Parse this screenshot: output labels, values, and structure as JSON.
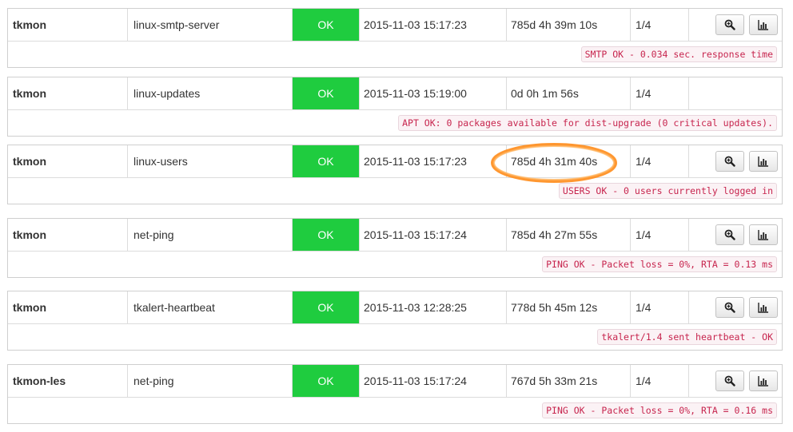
{
  "services": [
    {
      "host": "tkmon",
      "service": "linux-smtp-server",
      "state": "OK",
      "last_check": "2015-11-03 15:17:23",
      "duration": "785d 4h 39m 10s",
      "attempt": "1/4",
      "output": "SMTP OK - 0.034 sec. response time",
      "has_actions": true
    },
    {
      "host": "tkmon",
      "service": "linux-updates",
      "state": "OK",
      "last_check": "2015-11-03 15:19:00",
      "duration": "0d 0h 1m 56s",
      "attempt": "1/4",
      "output": "APT OK: 0 packages available for dist-upgrade (0 critical updates).",
      "has_actions": false
    },
    {
      "host": "tkmon",
      "service": "linux-users",
      "state": "OK",
      "last_check": "2015-11-03 15:17:23",
      "duration": "785d 4h 31m 40s",
      "attempt": "1/4",
      "output": "USERS OK - 0 users currently logged in",
      "has_actions": true
    },
    {
      "host": "tkmon",
      "service": "net-ping",
      "state": "OK",
      "last_check": "2015-11-03 15:17:24",
      "duration": "785d 4h 27m 55s",
      "attempt": "1/4",
      "output": "PING OK - Packet loss = 0%, RTA = 0.13 ms",
      "has_actions": true
    },
    {
      "host": "tkmon",
      "service": "tkalert-heartbeat",
      "state": "OK",
      "last_check": "2015-11-03 12:28:25",
      "duration": "778d 5h 45m 12s",
      "attempt": "1/4",
      "output": "tkalert/1.4 sent heartbeat - OK",
      "has_actions": true
    },
    {
      "host": "tkmon-les",
      "service": "net-ping",
      "state": "OK",
      "last_check": "2015-11-03 15:17:24",
      "duration": "767d 5h 33m 21s",
      "attempt": "1/4",
      "output": "PING OK - Packet loss = 0%, RTA = 0.16 ms",
      "has_actions": true
    }
  ],
  "icons": {
    "details": "zoom-icon",
    "graph": "bar-chart-icon"
  },
  "colors": {
    "state_ok": "#1fcc3f",
    "output_text": "#c7254e",
    "highlight": "#ff8c1a"
  }
}
